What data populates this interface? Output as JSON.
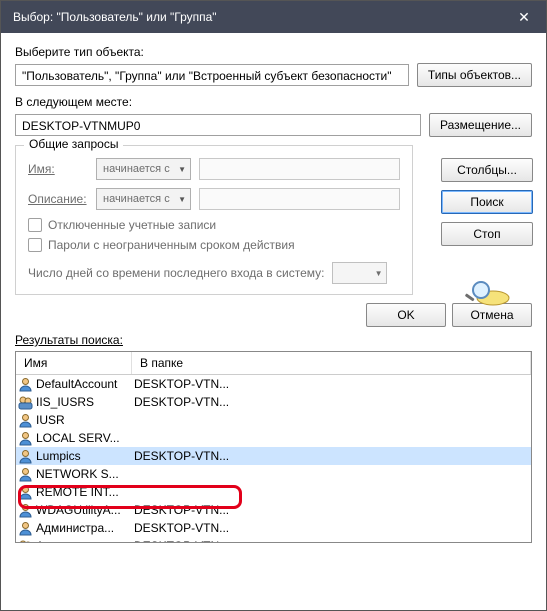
{
  "titlebar": {
    "title": "Выбор: \"Пользователь\" или \"Группа\""
  },
  "label_type": "Выберите тип объекта:",
  "field_type": "\"Пользователь\", \"Группа\" или \"Встроенный субъект безопасности\"",
  "btn_types": "Типы объектов...",
  "label_loc": "В следующем месте:",
  "field_loc": "DESKTOP-VTNMUP0",
  "btn_loc": "Размещение...",
  "group_title": "Общие запросы",
  "form": {
    "name_label": "Имя:",
    "desc_label": "Описание:",
    "combo_starts": "начинается с",
    "chk_disabled": "Отключенные учетные записи",
    "chk_noexpire": "Пароли с неограниченным сроком действия",
    "days_label": "Число дней со времени последнего входа в систему:"
  },
  "side": {
    "columns": "Столбцы...",
    "search": "Поиск",
    "stop": "Стоп"
  },
  "btn_ok": "OK",
  "btn_cancel": "Отмена",
  "results_label": "Результаты поиска:",
  "headers": {
    "name": "Имя",
    "folder": "В папке"
  },
  "rows": [
    {
      "name": "DefaultAccount",
      "folder": "DESKTOP-VTN...",
      "icon": "user",
      "selected": false
    },
    {
      "name": "IIS_IUSRS",
      "folder": "DESKTOP-VTN...",
      "icon": "group",
      "selected": false
    },
    {
      "name": "IUSR",
      "folder": "",
      "icon": "user",
      "selected": false
    },
    {
      "name": "LOCAL SERV...",
      "folder": "",
      "icon": "user",
      "selected": false
    },
    {
      "name": "Lumpics",
      "folder": "DESKTOP-VTN...",
      "icon": "user",
      "selected": true
    },
    {
      "name": "NETWORK S...",
      "folder": "",
      "icon": "user",
      "selected": false
    },
    {
      "name": "REMOTE INT...",
      "folder": "",
      "icon": "user",
      "selected": false
    },
    {
      "name": "WDAGUtilityA...",
      "folder": "DESKTOP-VTN...",
      "icon": "user",
      "selected": false
    },
    {
      "name": "Администра...",
      "folder": "DESKTOP-VTN...",
      "icon": "user",
      "selected": false
    },
    {
      "name": "Администра...",
      "folder": "DESKTOP-VTN...",
      "icon": "group",
      "selected": false
    }
  ]
}
